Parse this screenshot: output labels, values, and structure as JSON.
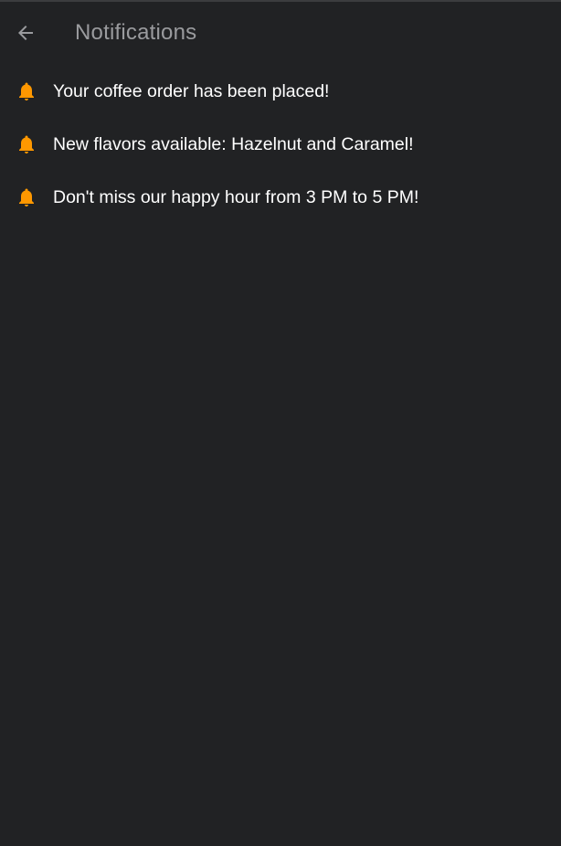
{
  "header": {
    "back_icon": "arrow-left-icon",
    "title": "Notifications"
  },
  "notifications": [
    {
      "icon": "bell-icon",
      "text": "Your coffee order has been placed!"
    },
    {
      "icon": "bell-icon",
      "text": "New flavors available: Hazelnut and Caramel!"
    },
    {
      "icon": "bell-icon",
      "text": "Don't miss our happy hour from 3 PM to 5 PM!"
    }
  ],
  "colors": {
    "background": "#212224",
    "accent": "#FF9800",
    "title": "#9A9B9E",
    "text": "#FFFFFF"
  }
}
